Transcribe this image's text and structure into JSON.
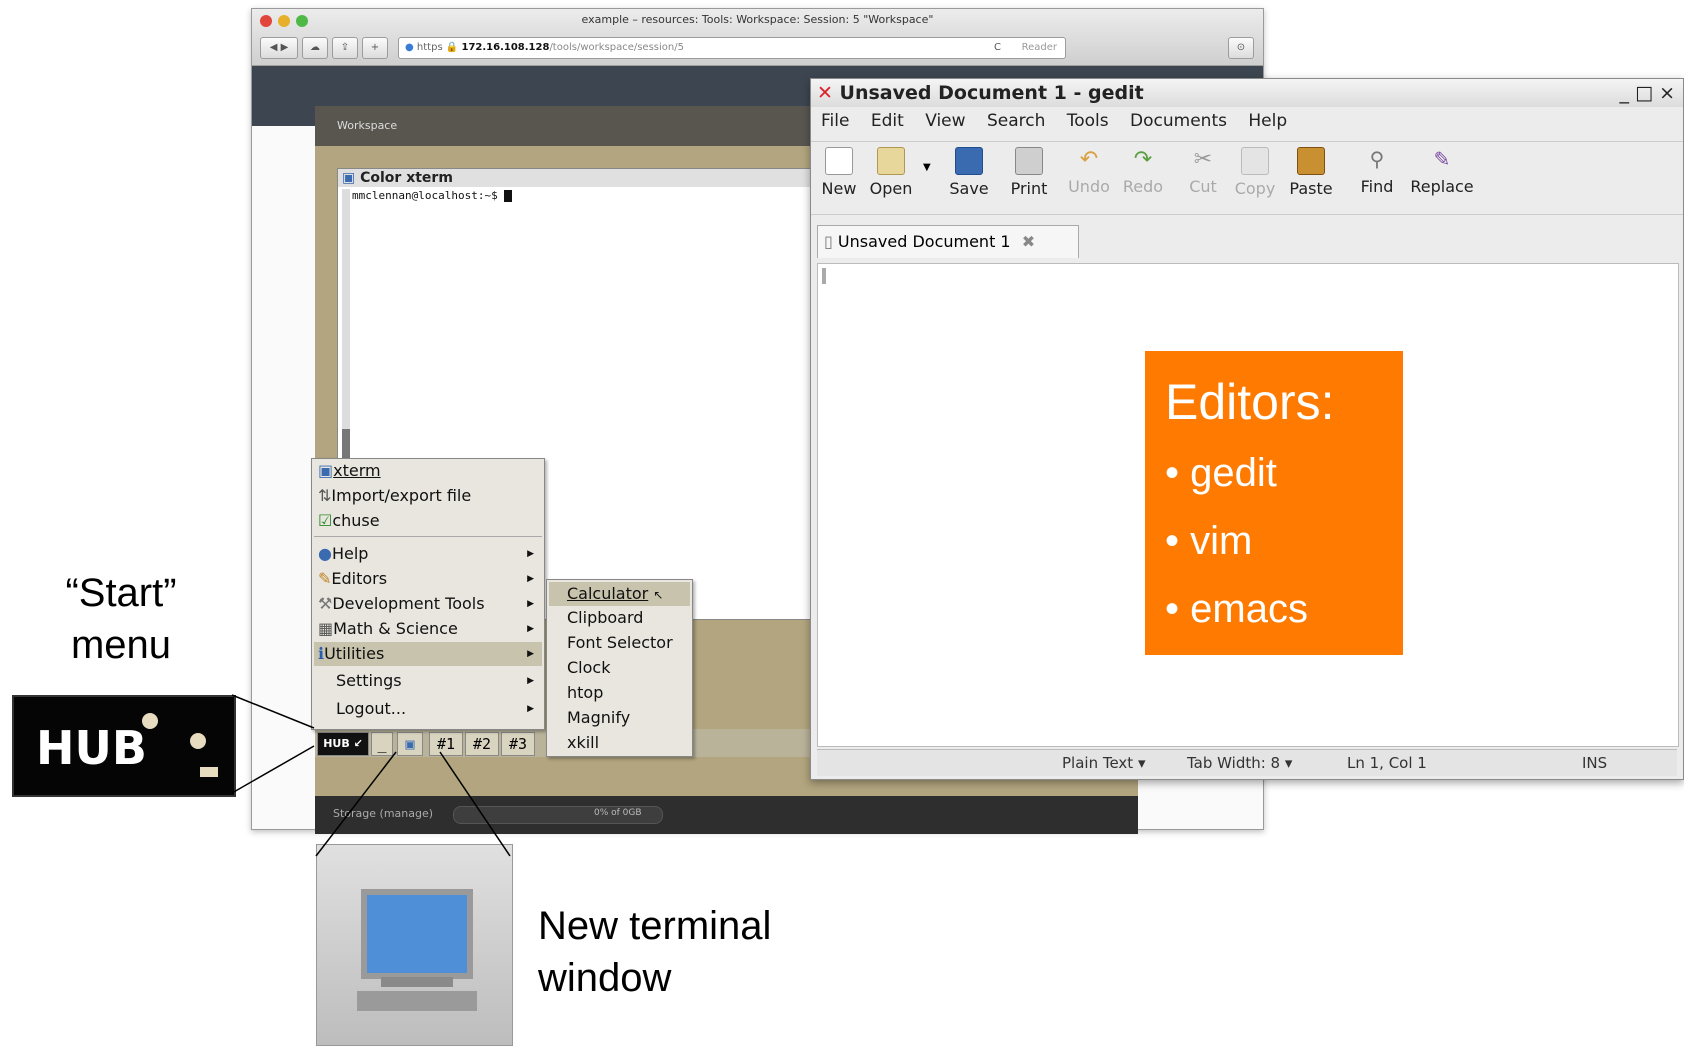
{
  "browser": {
    "title": "example – resources: Tools: Workspace: Session: 5 \"Workspace\"",
    "url_scheme": "https",
    "url_host": "172.16.108.128",
    "url_path": "/tools/workspace/session/5",
    "reader_label": "Reader"
  },
  "workspace": {
    "header": "Workspace",
    "storage_label": "Storage (manage)",
    "storage_value": "0% of 0GB"
  },
  "xterm": {
    "title": "Color xterm",
    "prompt": "mmclennan@localhost:~$ "
  },
  "start_menu": {
    "items": [
      {
        "label": "xterm",
        "icon": "terminal-icon"
      },
      {
        "label": "Import/export file",
        "icon": "import-icon"
      },
      {
        "label": "chuse",
        "icon": "check-icon"
      },
      {
        "label": "Help",
        "icon": "help-icon",
        "submenu": true
      },
      {
        "label": "Editors",
        "icon": "edit-icon",
        "submenu": true
      },
      {
        "label": "Development Tools",
        "icon": "wrench-icon",
        "submenu": true
      },
      {
        "label": "Math & Science",
        "icon": "math-icon",
        "submenu": true
      },
      {
        "label": "Utilities",
        "icon": "info-icon",
        "submenu": true,
        "selected": true
      },
      {
        "label": "Settings",
        "submenu": true
      },
      {
        "label": "Logout...",
        "submenu": true
      }
    ],
    "utilities_submenu": [
      "Calculator",
      "Clipboard",
      "Font Selector",
      "Clock",
      "htop",
      "Magnify",
      "xkill"
    ]
  },
  "taskbar": {
    "min_label": "_",
    "ws1": "#1",
    "ws2": "#2",
    "ws3": "#3"
  },
  "gedit": {
    "title": "Unsaved Document 1 - gedit",
    "window_controls": "_ □ ×",
    "menu": [
      "File",
      "Edit",
      "View",
      "Search",
      "Tools",
      "Documents",
      "Help"
    ],
    "toolbar": [
      {
        "label": "New",
        "icon": "new-document-icon",
        "enabled": true
      },
      {
        "label": "Open",
        "icon": "folder-icon",
        "enabled": true
      },
      {
        "label": "Save",
        "icon": "save-icon",
        "enabled": true
      },
      {
        "label": "Print",
        "icon": "printer-icon",
        "enabled": true
      },
      {
        "label": "Undo",
        "icon": "undo-icon",
        "enabled": false
      },
      {
        "label": "Redo",
        "icon": "redo-icon",
        "enabled": false
      },
      {
        "label": "Cut",
        "icon": "scissors-icon",
        "enabled": false
      },
      {
        "label": "Copy",
        "icon": "copy-icon",
        "enabled": false
      },
      {
        "label": "Paste",
        "icon": "paste-icon",
        "enabled": true
      },
      {
        "label": "Find",
        "icon": "find-icon",
        "enabled": true
      },
      {
        "label": "Replace",
        "icon": "replace-icon",
        "enabled": true
      }
    ],
    "tab_label": "Unsaved Document 1",
    "status": {
      "syntax": "Plain Text",
      "tab_width": "Tab Width:  8",
      "position": "Ln 1, Col 1",
      "mode": "INS"
    }
  },
  "annotations": {
    "editors_title": "Editors:",
    "editors_list": [
      "gedit",
      "vim",
      "emacs"
    ],
    "start_line1": "“Start”",
    "start_line2": "menu",
    "terminal_line1": "New terminal",
    "terminal_line2": "window",
    "hub_logo": "HUB",
    "orange_color": "#ff7a00"
  }
}
